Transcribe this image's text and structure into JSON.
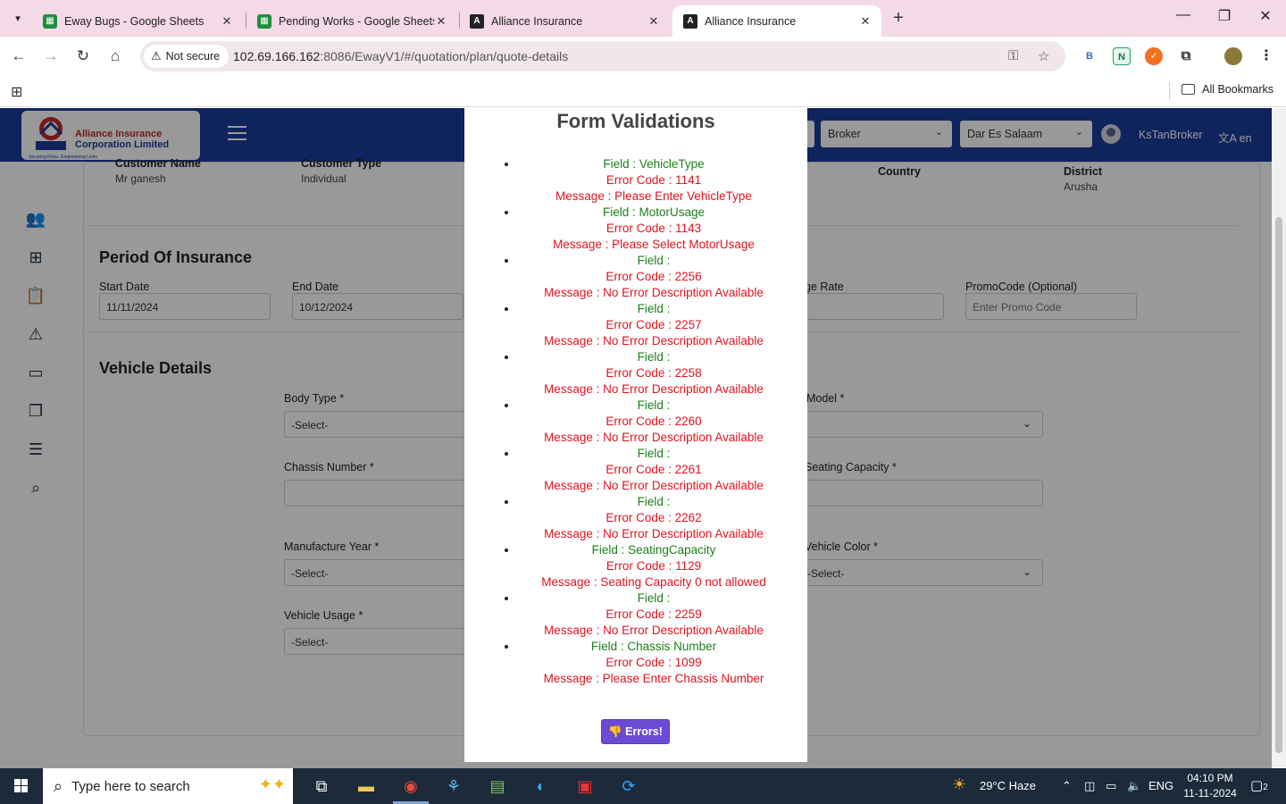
{
  "browser": {
    "tabs": [
      {
        "label": "Eway Bugs - Google Sheets",
        "icon": "sheets-icon"
      },
      {
        "label": "Pending Works - Google Sheets",
        "icon": "sheets-icon"
      },
      {
        "label": "Alliance Insurance",
        "icon": "angular-icon"
      },
      {
        "label": "Alliance Insurance",
        "icon": "angular-icon"
      }
    ],
    "security_label": "Not secure",
    "url_host": "102.69.166.162",
    "url_rest": ":8086/EwayV1/#/quotation/plan/quote-details",
    "bookmarks_label": "All Bookmarks"
  },
  "app": {
    "logo_line1": "Alliance Insurance",
    "logo_line2": "Corporation Limited",
    "logo_tag": "Securing Risks, Empowering Lives",
    "role_select": "Broker",
    "region_select": "Dar Es Salaam",
    "username": "KsTanBroker",
    "language": "en"
  },
  "customer": {
    "name_label": "Customer Name",
    "name_value": "Mr ganesh",
    "type_label": "Customer Type",
    "type_value": "Individual",
    "country_label": "Country",
    "district_label": "District",
    "district_value": "Arusha"
  },
  "period": {
    "title": "Period Of Insurance",
    "start_label": "Start Date",
    "start_value": "11/11/2024",
    "end_label": "End Date",
    "end_value": "10/12/2024",
    "rate_label_partial": "ge Rate",
    "promo_label": "PromoCode (Optional)",
    "promo_placeholder": "Enter Promo Code"
  },
  "vehicle": {
    "title": "Vehicle Details",
    "body_type_label": "Body Type *",
    "body_type_value": "-Select-",
    "model_label": "Model *",
    "chassis_label": "Chassis Number *",
    "seating_label": "Seating Capacity *",
    "year_label": "Manufacture Year *",
    "year_value": "-Select-",
    "color_label": "Vehicle Color *",
    "color_value": "-Select-",
    "usage_label": "Vehicle Usage *",
    "usage_value": "-Select-"
  },
  "modal": {
    "title": "Form Validations",
    "field_prefix": "Field  :  ",
    "code_prefix": "Error Code  :  ",
    "msg_prefix": "Message  :  ",
    "errors": [
      {
        "field": "VehicleType",
        "code": "1141",
        "message": "Please Enter VehicleType"
      },
      {
        "field": "MotorUsage",
        "code": "1143",
        "message": "Please Select MotorUsage"
      },
      {
        "field": "",
        "code": "2256",
        "message": "No Error Description Available"
      },
      {
        "field": "",
        "code": "2257",
        "message": "No Error Description Available"
      },
      {
        "field": "",
        "code": "2258",
        "message": "No Error Description Available"
      },
      {
        "field": "",
        "code": "2260",
        "message": "No Error Description Available"
      },
      {
        "field": "",
        "code": "2261",
        "message": "No Error Description Available"
      },
      {
        "field": "",
        "code": "2262",
        "message": "No Error Description Available"
      },
      {
        "field": "SeatingCapacity",
        "code": "1129",
        "message": "Seating Capacity 0 not allowed"
      },
      {
        "field": "",
        "code": "2259",
        "message": "No Error Description Available"
      },
      {
        "field": "Chassis Number",
        "code": "1099",
        "message": "Please Enter Chassis Number"
      }
    ],
    "button_label": "Errors!"
  },
  "taskbar": {
    "search_placeholder": "Type here to search",
    "weather": "29°C  Haze",
    "lang": "ENG",
    "time": "04:10 PM",
    "date": "11-11-2024",
    "notifications": "2"
  },
  "colors": {
    "appbar": "#1a3b9c",
    "field_green": "#1b7f1b",
    "error_red": "#e0141e",
    "button_purple": "#6c4ad6"
  }
}
